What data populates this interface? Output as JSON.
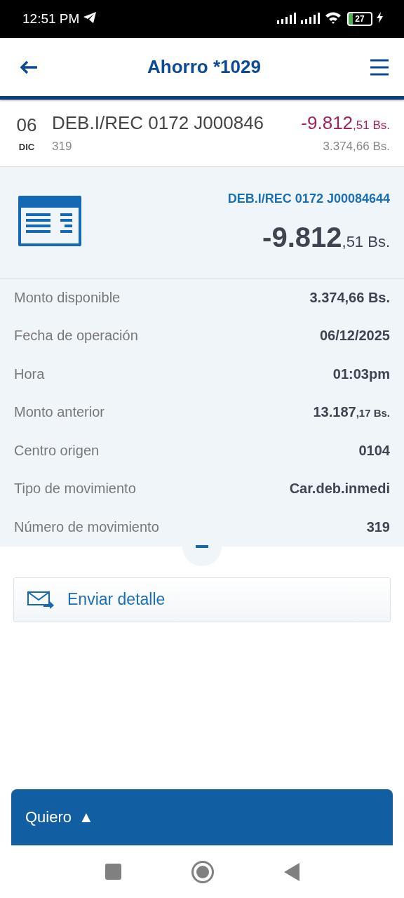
{
  "status_bar": {
    "time": "12:51 PM",
    "battery": "27"
  },
  "header": {
    "title": "Ahorro *1029"
  },
  "transaction": {
    "day": "06",
    "month": "DIC",
    "description": "DEB.I/REC 0172 J000846",
    "reference": "319",
    "amount": {
      "integer": "-9.812",
      "decimals": ",51 Bs."
    },
    "balance": "3.374,66 Bs."
  },
  "detail": {
    "title": "DEB.I/REC 0172 J00084644",
    "amount": {
      "integer": "-9.812",
      "decimals": ",51 Bs."
    },
    "rows": [
      {
        "label": "Monto disponible",
        "kind": "text",
        "value": "3.374,66 Bs."
      },
      {
        "label": "Fecha de operación",
        "kind": "text",
        "value": "06/12/2025"
      },
      {
        "label": "Hora",
        "kind": "text",
        "value": "01:03pm"
      },
      {
        "label": "Monto anterior",
        "kind": "amount",
        "integer": "13.187",
        "decimals": ",17 Bs."
      },
      {
        "label": "Centro origen",
        "kind": "text",
        "value": "0104"
      },
      {
        "label": "Tipo de movimiento",
        "kind": "text",
        "value": "Car.deb.inmedi"
      },
      {
        "label": "Número de movimiento",
        "kind": "text",
        "value": "319"
      }
    ],
    "expanded": true
  },
  "send_button": {
    "label": "Enviar detalle"
  },
  "bottom_bar": {
    "label": "Quiero",
    "arrow": "▲"
  }
}
